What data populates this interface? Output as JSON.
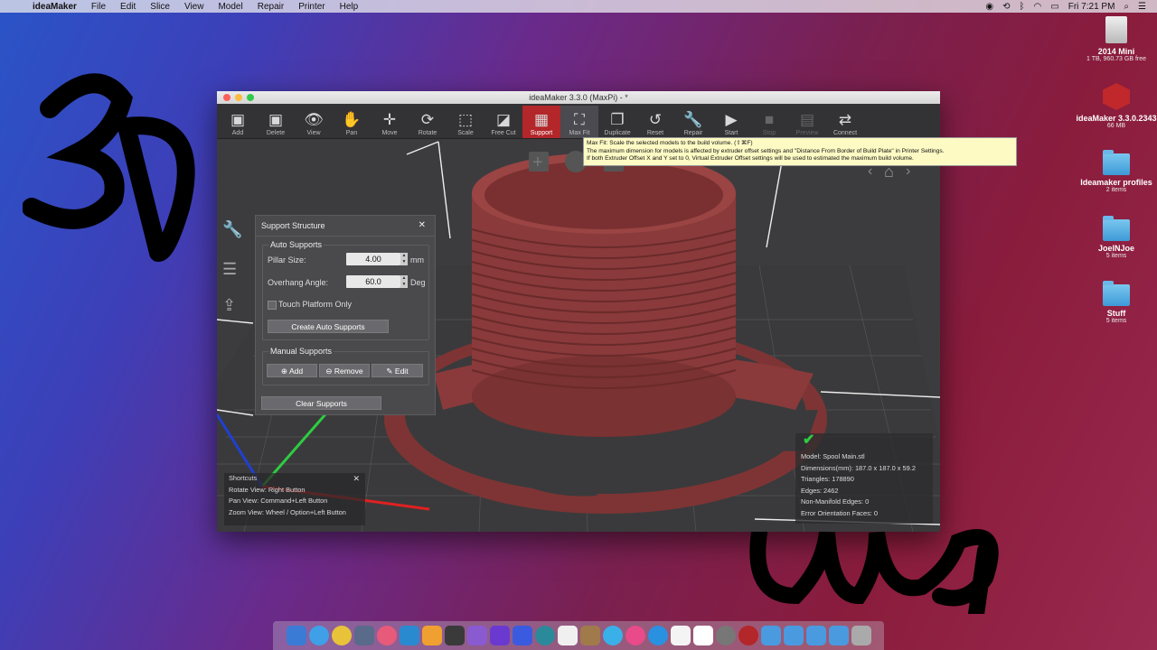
{
  "menubar": {
    "items": [
      "ideaMaker",
      "File",
      "Edit",
      "Slice",
      "View",
      "Model",
      "Repair",
      "Printer",
      "Help"
    ],
    "clock": "Fri 7:21 PM"
  },
  "desktop": {
    "icons": [
      {
        "label": "2014 Mini",
        "sub": "1 TB, 960.73 GB free"
      },
      {
        "label": "ideaMaker 3.3.0.2343",
        "sub": "66 MB"
      },
      {
        "label": "Ideamaker profiles",
        "sub": "2 items"
      },
      {
        "label": "JoelNJoe",
        "sub": "5 items"
      },
      {
        "label": "Stuff",
        "sub": "5 items"
      }
    ]
  },
  "window": {
    "title": "ideaMaker 3.3.0 (MaxPi) - *"
  },
  "toolbar": {
    "items": [
      {
        "label": "Add",
        "icon": "cube-add-icon",
        "glyph": "▣"
      },
      {
        "label": "Delete",
        "icon": "cube-delete-icon",
        "glyph": "▣"
      },
      {
        "label": "View",
        "icon": "eye-icon",
        "glyph": "👁"
      },
      {
        "label": "Pan",
        "icon": "hand-icon",
        "glyph": "✋"
      },
      {
        "label": "Move",
        "icon": "move-icon",
        "glyph": "✛"
      },
      {
        "label": "Rotate",
        "icon": "rotate-icon",
        "glyph": "⟳"
      },
      {
        "label": "Scale",
        "icon": "scale-icon",
        "glyph": "⬚"
      },
      {
        "label": "Free Cut",
        "icon": "cut-icon",
        "glyph": "◪"
      },
      {
        "label": "Support",
        "icon": "support-icon",
        "glyph": "▦"
      },
      {
        "label": "Max Fit",
        "icon": "maxfit-icon",
        "glyph": "⛶"
      },
      {
        "label": "Duplicate",
        "icon": "duplicate-icon",
        "glyph": "❐"
      },
      {
        "label": "Reset",
        "icon": "reset-icon",
        "glyph": "↺"
      },
      {
        "label": "Repair",
        "icon": "wrench-icon",
        "glyph": "🔧"
      },
      {
        "label": "Start",
        "icon": "play-icon",
        "glyph": "▶"
      },
      {
        "label": "Stop",
        "icon": "stop-icon",
        "glyph": "■"
      },
      {
        "label": "Preview",
        "icon": "preview-icon",
        "glyph": "▤"
      },
      {
        "label": "Connect",
        "icon": "connect-icon",
        "glyph": "⇄"
      }
    ]
  },
  "tooltip": {
    "lines": [
      "Max Fit: Scale the selected models to the build volume. (⇧⌘F)",
      "The maximum dimension for models is affected by extruder offset settings and \"Distance From Border of Build Plate\" in Printer Settings.",
      "If both Extruder Offset X and Y set to 0, Virtual Extruder Offset settings will be used to estimated the maximum build volume."
    ]
  },
  "support_panel": {
    "title": "Support Structure",
    "auto_title": "Auto Supports",
    "pillar_label": "Pillar Size:",
    "pillar_value": "4.00",
    "pillar_unit": "mm",
    "overhang_label": "Overhang Angle:",
    "overhang_value": "60.0",
    "overhang_unit": "Deg",
    "touch_label": "Touch Platform Only",
    "create_btn": "Create Auto Supports",
    "manual_title": "Manual Supports",
    "add_btn": "Add",
    "remove_btn": "Remove",
    "edit_btn": "Edit",
    "clear_btn": "Clear Supports"
  },
  "shortcuts": {
    "title": "Shortcuts",
    "lines": [
      "Rotate View: Right Button",
      "Pan View: Command+Left Button",
      "Zoom View: Wheel / Option+Left Button"
    ]
  },
  "model_info": {
    "lines": [
      "Model: Spool Main.stl",
      "Dimensions(mm): 187.0 x 187.0 x 59.2",
      "Triangles: 178890",
      "Edges: 2462",
      "Non-Manifold Edges: 0",
      "Error Orientation Faces: 0"
    ]
  },
  "colors": {
    "accent": "#b3262a",
    "model": "#8a3a3a"
  }
}
